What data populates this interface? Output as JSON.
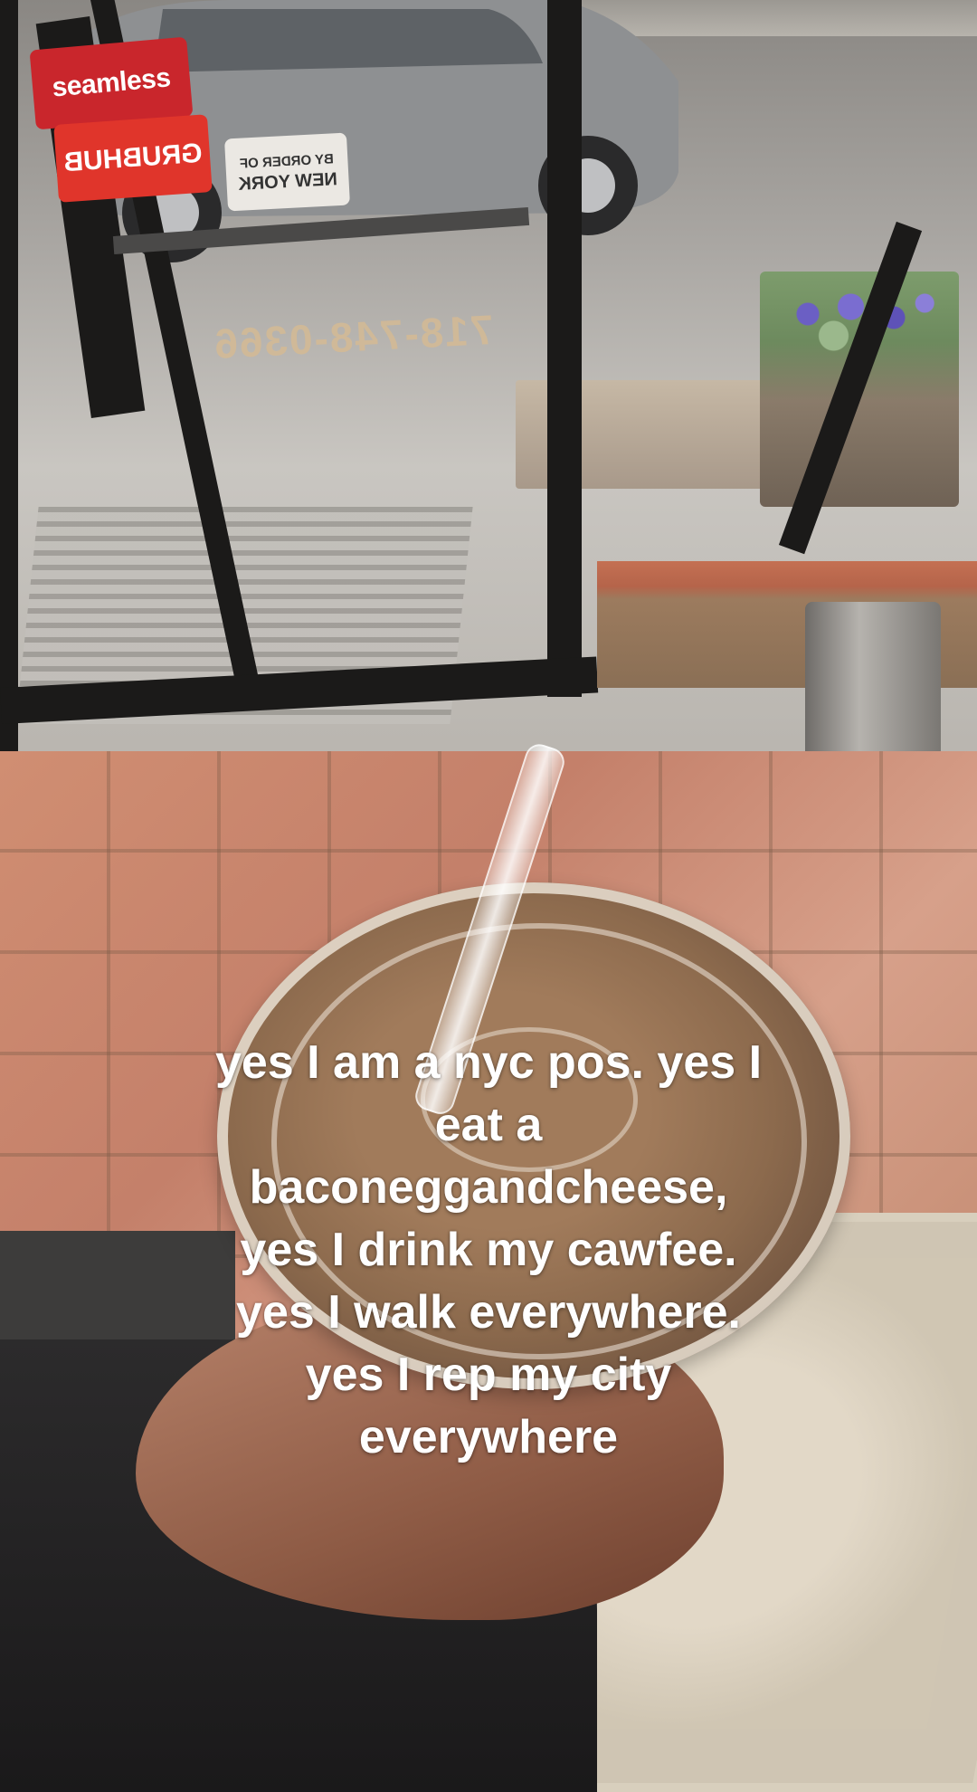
{
  "window_decals": {
    "seamless": "seamless",
    "grubhub": "GRUBHUB",
    "nyc_line1": "BY ORDER OF",
    "nyc_line2": "NEW YORK",
    "phone": "718-748-0366"
  },
  "caption": {
    "lines": [
      "yes I am a nyc pos. yes I",
      "eat a",
      "baconeggandcheese,",
      "yes I drink my cawfee.",
      "yes I walk everywhere.",
      "yes I rep my city",
      "everywhere"
    ]
  },
  "colors": {
    "caption_text": "#ffffff",
    "seamless_red": "#c9262c",
    "grubhub_red": "#e0352b"
  }
}
